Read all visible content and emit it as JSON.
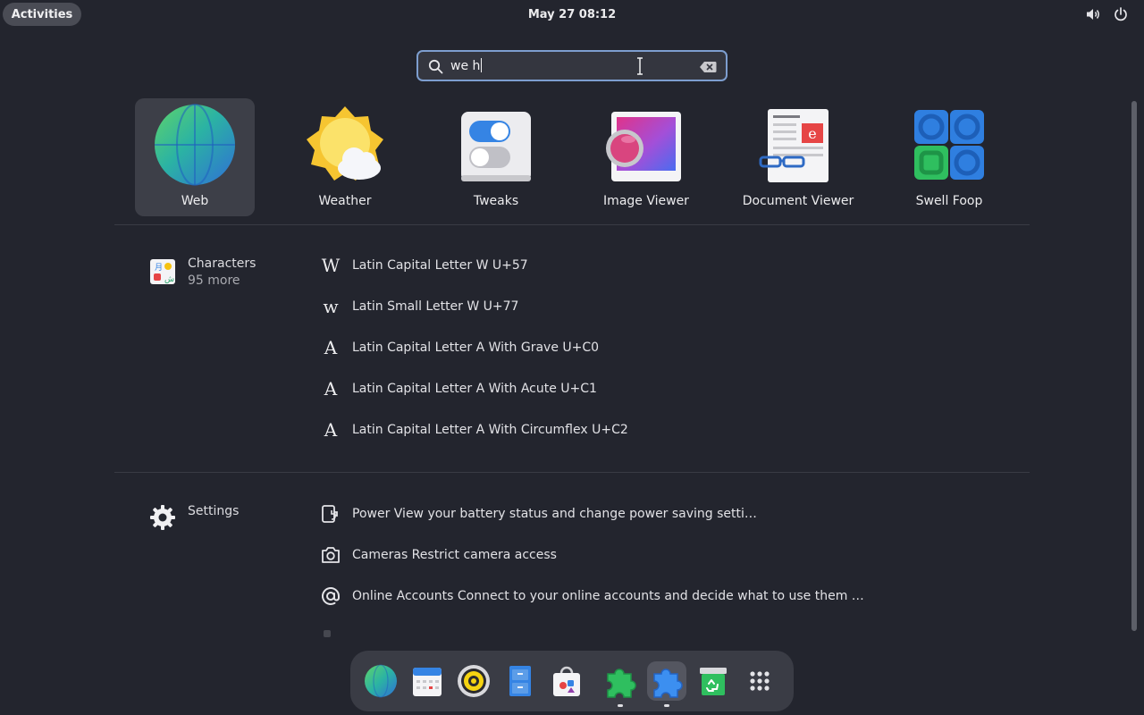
{
  "topbar": {
    "activities_label": "Activities",
    "clock": "May 27  08:12",
    "tray": [
      "volume-icon",
      "power-icon"
    ]
  },
  "search": {
    "value": "we h",
    "icon": "search-icon",
    "clear_icon": "clear-icon"
  },
  "apps": [
    {
      "label": "Web",
      "icon": "globe-icon",
      "selected": true
    },
    {
      "label": "Weather",
      "icon": "weather-icon",
      "selected": false
    },
    {
      "label": "Tweaks",
      "icon": "tweaks-icon",
      "selected": false
    },
    {
      "label": "Image Viewer",
      "icon": "image-viewer-icon",
      "selected": false
    },
    {
      "label": "Document Viewer",
      "icon": "document-viewer-icon",
      "selected": false
    },
    {
      "label": "Swell Foop",
      "icon": "swell-foop-icon",
      "selected": false
    }
  ],
  "characters": {
    "name": "Characters",
    "more": "95 more",
    "results": [
      {
        "glyph": "W",
        "text": "Latin Capital Letter W  U+57"
      },
      {
        "glyph": "w",
        "text": "Latin Small Letter W  U+77"
      },
      {
        "glyph": "A",
        "text": "Latin Capital Letter A With Grave  U+C0"
      },
      {
        "glyph": "A",
        "text": "Latin Capital Letter A With Acute  U+C1"
      },
      {
        "glyph": "A",
        "text": "Latin Capital Letter A With Circumflex  U+C2"
      }
    ]
  },
  "settings": {
    "name": "Settings",
    "results": [
      {
        "icon": "power-plug-icon",
        "text": "Power  View your battery status and change power saving setti…"
      },
      {
        "icon": "camera-icon",
        "text": "Cameras  Restrict camera access"
      },
      {
        "icon": "at-sign-icon",
        "text": "Online Accounts  Connect to your online accounts and decide what to use them …"
      }
    ]
  },
  "dock": [
    {
      "name": "web",
      "icon": "globe-icon"
    },
    {
      "name": "calendar",
      "icon": "calendar-icon"
    },
    {
      "name": "rhythmbox",
      "icon": "speaker-icon"
    },
    {
      "name": "files",
      "icon": "file-cabinet-icon"
    },
    {
      "name": "software",
      "icon": "software-bag-icon"
    },
    {
      "name": "extensions",
      "icon": "green-puzzle-icon"
    },
    {
      "name": "extension-manager",
      "icon": "blue-puzzle-icon"
    },
    {
      "name": "trash",
      "icon": "trash-icon"
    },
    {
      "name": "show-apps",
      "icon": "app-grid-icon"
    }
  ],
  "colors": {
    "background": "#23252e",
    "accent": "#7d9ecf",
    "selected_tile": "#3d3f48",
    "dock": "#3a3c45"
  }
}
